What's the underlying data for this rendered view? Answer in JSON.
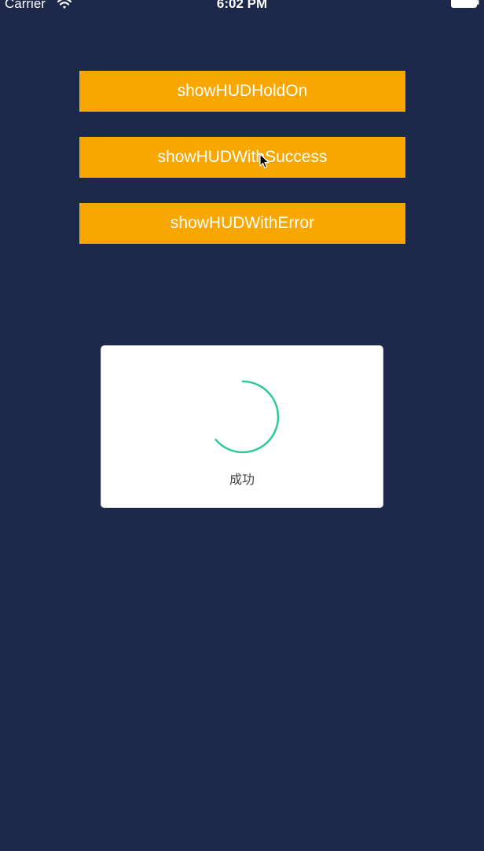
{
  "status_bar": {
    "carrier": "Carrier",
    "time": "6:02 PM",
    "icons": [
      "wifi-icon",
      "battery-icon"
    ]
  },
  "buttons": [
    {
      "label": "showHUDHoldOn"
    },
    {
      "label": "showHUDWithSuccess"
    },
    {
      "label": "showHUDWithError"
    }
  ],
  "hud": {
    "message": "成功",
    "icon": "spinner-icon"
  },
  "colors": {
    "background": "#1c294a",
    "button": "#f7a700",
    "button_text": "#ffffff",
    "spinner": "#2ec99a",
    "hud_background": "#ffffff",
    "hud_text": "#444444"
  }
}
